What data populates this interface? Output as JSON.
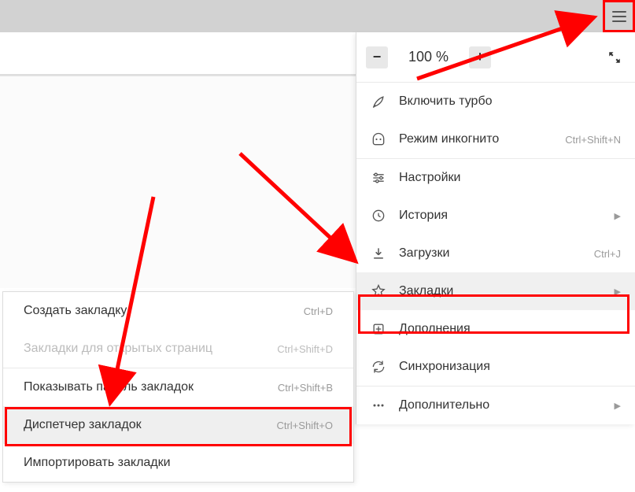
{
  "zoom": {
    "minus": "−",
    "value": "100 %",
    "plus": "+"
  },
  "menu": {
    "turbo": "Включить турбо",
    "incognito": {
      "label": "Режим инкогнито",
      "shortcut": "Ctrl+Shift+N"
    },
    "settings": "Настройки",
    "history": "История",
    "downloads": {
      "label": "Загрузки",
      "shortcut": "Ctrl+J"
    },
    "bookmarks": "Закладки",
    "addons": "Дополнения",
    "sync": "Синхронизация",
    "more": "Дополнительно"
  },
  "submenu": {
    "create": {
      "label": "Создать закладку",
      "shortcut": "Ctrl+D"
    },
    "open_tabs": {
      "label": "Закладки для открытых страниц",
      "shortcut": "Ctrl+Shift+D"
    },
    "show_bar": {
      "label": "Показывать панель закладок",
      "shortcut": "Ctrl+Shift+B"
    },
    "manager": {
      "label": "Диспетчер закладок",
      "shortcut": "Ctrl+Shift+O"
    },
    "import": "Импортировать закладки"
  }
}
